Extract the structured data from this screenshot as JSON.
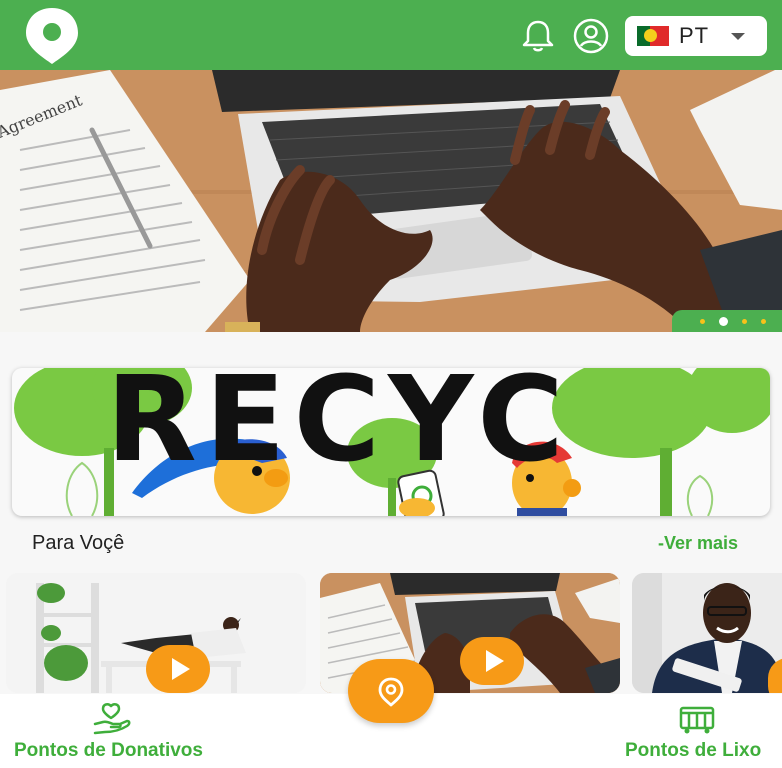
{
  "header": {
    "language_code": "PT",
    "brand_color": "#4caf50",
    "icons": [
      "map-pin-icon",
      "bell-icon",
      "user-circle-icon",
      "portugal-flag-icon",
      "caret-down-icon"
    ]
  },
  "hero": {
    "slide_count": 4,
    "active_slide": 1,
    "document_text": "Agreement"
  },
  "banner": {
    "word": "RECYC"
  },
  "section": {
    "title": "Para Voçê",
    "see_more": "-Ver mais"
  },
  "cards": [
    {
      "icon": "play-icon"
    },
    {
      "icon": "play-icon"
    },
    {
      "icon": "play-icon"
    }
  ],
  "bottom_nav": {
    "left_label": "Pontos de Donativos",
    "right_label": "Pontos de Lixo",
    "accent_color": "#3fae3b",
    "fab_color": "#f79a17"
  }
}
